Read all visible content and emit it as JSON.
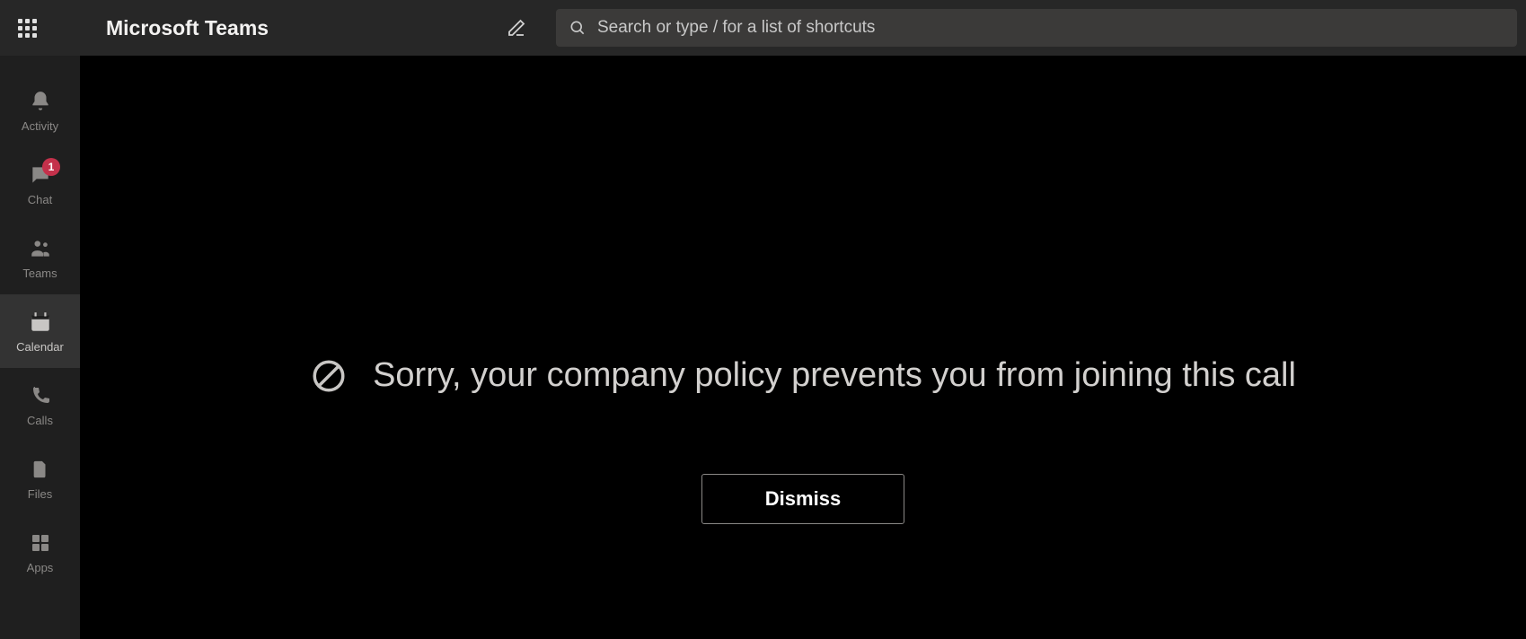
{
  "header": {
    "app_title": "Microsoft Teams",
    "search_placeholder": "Search or type / for a list of shortcuts"
  },
  "rail": {
    "items": [
      {
        "id": "activity",
        "label": "Activity",
        "icon": "bell-icon",
        "badge": null,
        "active": false
      },
      {
        "id": "chat",
        "label": "Chat",
        "icon": "chat-icon",
        "badge": "1",
        "active": false
      },
      {
        "id": "teams",
        "label": "Teams",
        "icon": "teams-icon",
        "badge": null,
        "active": false
      },
      {
        "id": "calendar",
        "label": "Calendar",
        "icon": "calendar-icon",
        "badge": null,
        "active": true
      },
      {
        "id": "calls",
        "label": "Calls",
        "icon": "phone-icon",
        "badge": null,
        "active": false
      },
      {
        "id": "files",
        "label": "Files",
        "icon": "file-icon",
        "badge": null,
        "active": false
      },
      {
        "id": "apps",
        "label": "Apps",
        "icon": "apps-icon",
        "badge": null,
        "active": false
      }
    ]
  },
  "error": {
    "message": "Sorry, your company policy prevents you from joining this call",
    "dismiss_label": "Dismiss"
  }
}
